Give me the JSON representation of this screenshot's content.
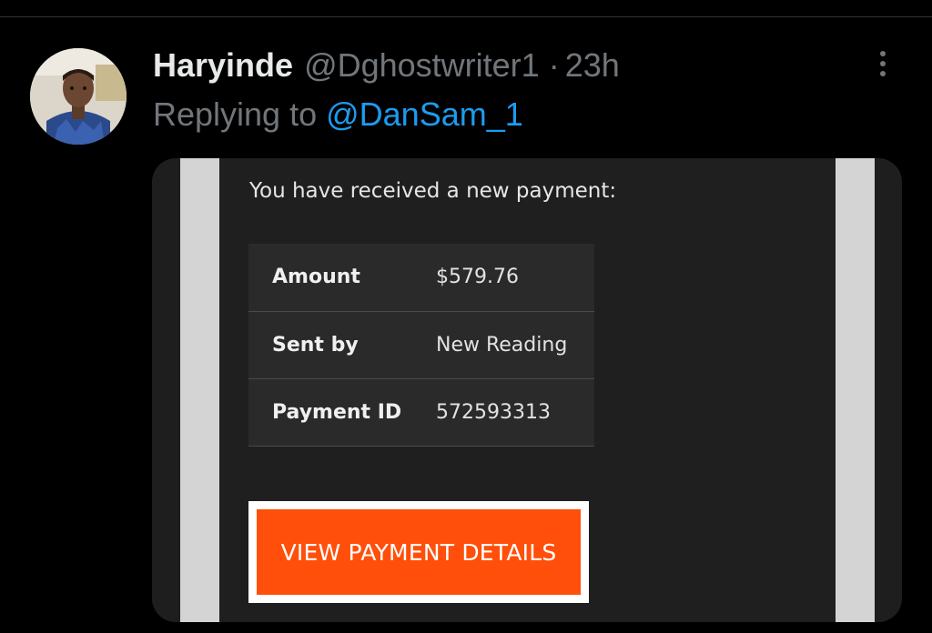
{
  "tweet": {
    "display_name": "Haryinde",
    "handle": "@Dghostwriter1",
    "separator": "·",
    "time": "23h",
    "replying_prefix": "Replying to",
    "replying_to": "@DanSam_1",
    "more_icon": "more-vertical-icon"
  },
  "email": {
    "intro": "You have received a new payment:",
    "rows": [
      {
        "label": "Amount",
        "value": "$579.76"
      },
      {
        "label": "Sent by",
        "value": "New Reading"
      },
      {
        "label": "Payment ID",
        "value": "572593313"
      }
    ],
    "button_label": "VIEW PAYMENT DETAILS"
  },
  "colors": {
    "background": "#000000",
    "mention": "#1d9bf0",
    "muted_text": "#71767b",
    "cta_button": "#ff4f0a",
    "email_background": "#1f1f1f",
    "side_strips": "#d4d4d4"
  }
}
